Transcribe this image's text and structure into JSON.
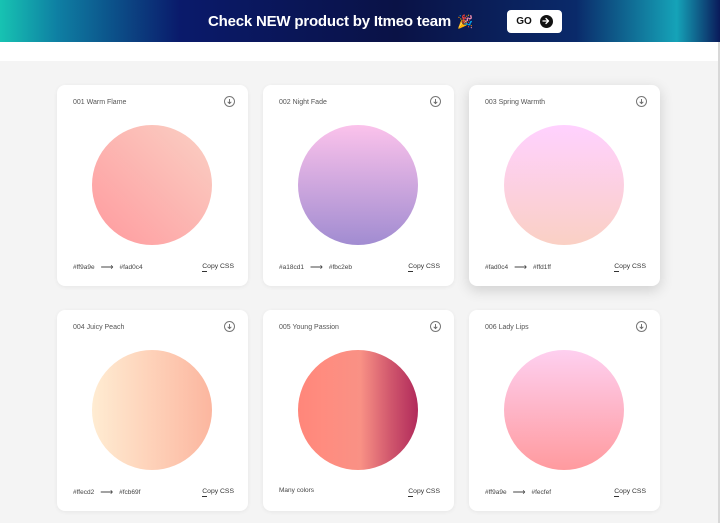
{
  "banner": {
    "text": "Check NEW product by Itmeo team",
    "icon": "party-popper-icon",
    "go_label": "GO"
  },
  "gradients": [
    {
      "title": "001 Warm Flame",
      "from": "#ff9a9e",
      "to": "#fad0c4",
      "colors_text": null,
      "copy_label": "Copy CSS"
    },
    {
      "title": "002 Night Fade",
      "from": "#a18cd1",
      "to": "#fbc2eb",
      "colors_text": null,
      "copy_label": "Copy CSS"
    },
    {
      "title": "003 Spring Warmth",
      "from": "#fad0c4",
      "to": "#ffd1ff",
      "colors_text": null,
      "copy_label": "Copy CSS"
    },
    {
      "title": "004 Juicy Peach",
      "from": "#ffecd2",
      "to": "#fcb69f",
      "colors_text": null,
      "copy_label": "Copy CSS"
    },
    {
      "title": "005 Young Passion",
      "from": null,
      "to": null,
      "colors_text": "Many colors",
      "copy_label": "Copy CSS"
    },
    {
      "title": "006 Lady Lips",
      "from": "#ff9a9e",
      "to": "#fecfef",
      "colors_text": null,
      "copy_label": "Copy CSS"
    }
  ]
}
